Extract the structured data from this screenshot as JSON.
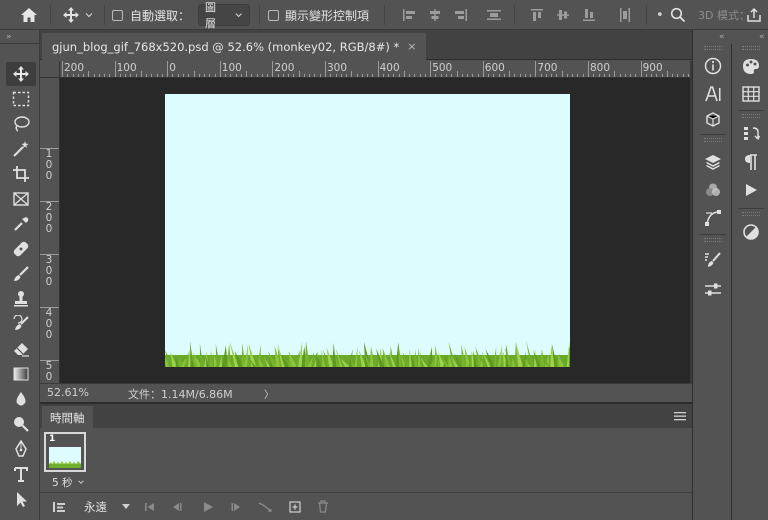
{
  "options_bar": {
    "auto_select_label": "自動選取：",
    "auto_select_target": "圖層",
    "show_transform_label": "顯示變形控制項",
    "mode_3d_label": "3D 模式："
  },
  "document": {
    "tab_title": "gjun_blog_gif_768x520.psd @ 52.6% (monkey02, RGB/8#) *",
    "close_glyph": "×"
  },
  "rulers": {
    "horizontal": [
      "200",
      "100",
      "0",
      "100",
      "200",
      "300",
      "400",
      "500",
      "600",
      "700",
      "800",
      "900"
    ],
    "vertical": [
      [
        "1",
        "0",
        "0"
      ],
      [
        "2",
        "0",
        "0"
      ],
      [
        "3",
        "0",
        "0"
      ],
      [
        "4",
        "0",
        "0"
      ],
      [
        "5",
        "0"
      ]
    ]
  },
  "status": {
    "zoom": "52.61%",
    "doc_size": "文件：1.14M/6.86M",
    "arrow": "〉"
  },
  "timeline": {
    "panel_title": "時間軸",
    "frame_number": "1",
    "frame_delay": "5 秒",
    "loop_option": "永遠"
  },
  "colors": {
    "app_bg": "#535353",
    "workspace_bg": "#282828",
    "sky": "#dcfcfd",
    "grass": "#7ab42c"
  },
  "icons": {
    "options": [
      "home-icon",
      "move-tool-icon",
      "align-icons",
      "search-icon",
      "share-icon"
    ],
    "toolbar": [
      "move-icon",
      "marquee-icon",
      "lasso-icon",
      "magic-wand-icon",
      "crop-icon",
      "frame-icon",
      "eyedropper-icon",
      "healing-icon",
      "brush-icon",
      "stamp-icon",
      "history-brush-icon",
      "eraser-icon",
      "gradient-icon",
      "blur-icon",
      "dodge-icon",
      "pen-icon",
      "type-icon",
      "path-select-icon"
    ],
    "panels": [
      "info-icon",
      "character-icon",
      "3d-icon",
      "layers-icon",
      "channels-icon",
      "paths-icon",
      "brushes-icon",
      "properties-icon",
      "color-icon",
      "swatches-icon",
      "paragraph-styles-icon",
      "paragraph-icon",
      "actions-icon",
      "adjustments-icon"
    ]
  }
}
